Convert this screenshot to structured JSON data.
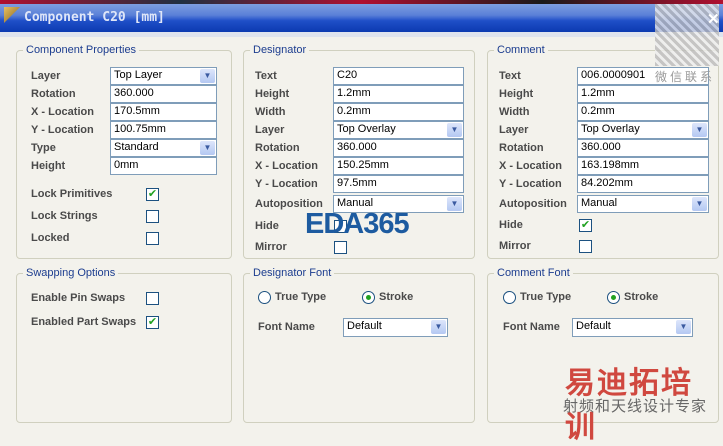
{
  "window": {
    "title": "Component C20 [mm]"
  },
  "component_properties": {
    "title": "Component Properties",
    "fields": [
      {
        "label": "Layer",
        "value": "Top Layer",
        "type": "select"
      },
      {
        "label": "Rotation",
        "value": "360.000"
      },
      {
        "label": "X - Location",
        "value": "170.5mm"
      },
      {
        "label": "Y - Location",
        "value": "100.75mm"
      },
      {
        "label": "Type",
        "value": "Standard",
        "type": "select"
      },
      {
        "label": "Height",
        "value": "0mm"
      }
    ],
    "checks": [
      {
        "label": "Lock Primitives",
        "checked": true
      },
      {
        "label": "Lock Strings",
        "checked": false
      },
      {
        "label": "Locked",
        "checked": false
      }
    ]
  },
  "designator": {
    "title": "Designator",
    "fields": [
      {
        "label": "Text",
        "value": "C20"
      },
      {
        "label": "Height",
        "value": "1.2mm"
      },
      {
        "label": "Width",
        "value": "0.2mm"
      },
      {
        "label": "Layer",
        "value": "Top Overlay"
      },
      {
        "label": "Rotation",
        "value": "360.000"
      },
      {
        "label": "X - Location",
        "value": "150.25mm"
      },
      {
        "label": "Y - Location",
        "value": "97.5mm"
      },
      {
        "label": "Autoposition",
        "value": "Manual"
      }
    ],
    "checks": [
      {
        "label": "Hide",
        "checked": false
      },
      {
        "label": "Mirror",
        "checked": false
      }
    ]
  },
  "comment": {
    "title": "Comment",
    "fields": [
      {
        "label": "Text",
        "value": "006.0000901"
      },
      {
        "label": "Height",
        "value": "1.2mm"
      },
      {
        "label": "Width",
        "value": "0.2mm"
      },
      {
        "label": "Layer",
        "value": "Top Overlay"
      },
      {
        "label": "Rotation",
        "value": "360.000"
      },
      {
        "label": "X - Location",
        "value": "163.198mm"
      },
      {
        "label": "Y - Location",
        "value": "84.202mm"
      },
      {
        "label": "Autoposition",
        "value": "Manual"
      }
    ],
    "checks": [
      {
        "label": "Hide",
        "checked": true
      },
      {
        "label": "Mirror",
        "checked": false
      }
    ]
  },
  "swapping": {
    "title": "Swapping Options",
    "checks": [
      {
        "label": "Enable Pin Swaps",
        "checked": false
      },
      {
        "label": "Enabled Part Swaps",
        "checked": true
      }
    ]
  },
  "designator_font": {
    "title": "Designator Font",
    "true_type": "True Type",
    "stroke": "Stroke",
    "selected": "stroke",
    "font_name_label": "Font Name",
    "font_name": "Default"
  },
  "comment_font": {
    "title": "Comment Font",
    "true_type": "True Type",
    "stroke": "Stroke",
    "selected": "stroke",
    "font_name_label": "Font Name",
    "font_name": "Default"
  },
  "watermarks": {
    "eda": "EDA365",
    "cn": "易迪拓培训",
    "cn_sub": "射频和天线设计专家",
    "wechat": "微信联系"
  }
}
